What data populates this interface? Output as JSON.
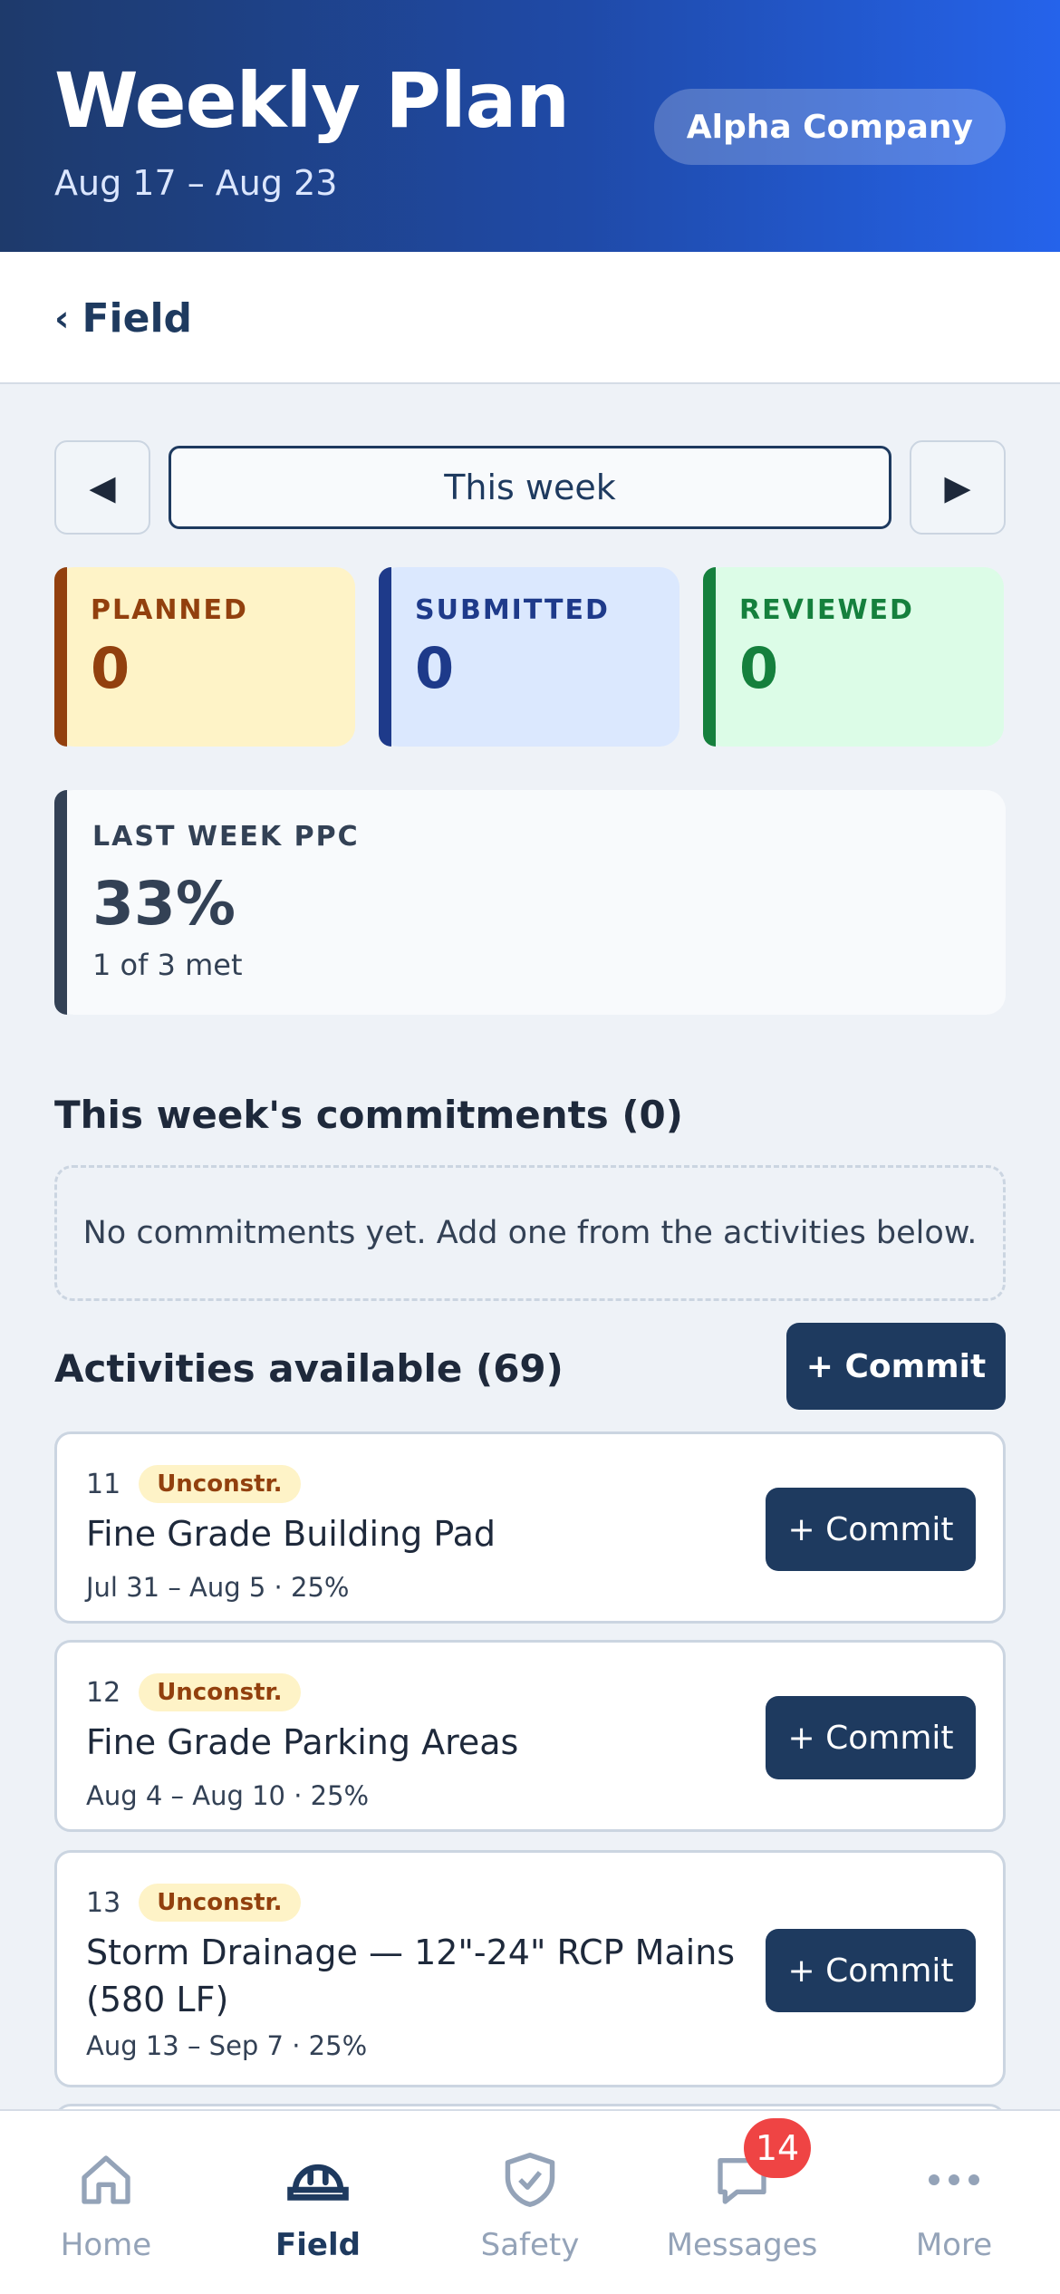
{
  "header": {
    "title": "Weekly Plan",
    "date_range": "Aug 17 – Aug 23",
    "company": "Alpha Company"
  },
  "back_nav": {
    "label": "Field",
    "icon": "chevron-left-icon"
  },
  "week_nav": {
    "prev_icon": "◀",
    "current": "This week",
    "next_icon": "▶"
  },
  "stats": [
    {
      "label": "PLANNED",
      "value": "0",
      "color": "#92400e"
    },
    {
      "label": "SUBMITTED",
      "value": "0",
      "color": "#1e3a8a"
    },
    {
      "label": "REVIEWED",
      "value": "0",
      "color": "#15803d"
    }
  ],
  "ppc": {
    "label": "LAST WEEK PPC",
    "value": "33%",
    "detail": "1 of 3 met"
  },
  "commitments": {
    "title": "This week's commitments (0)",
    "empty_message": "No commitments yet. Add one from the activities below."
  },
  "activities": {
    "title": "Activities available (69)",
    "commit_label": "+ Commit",
    "items": [
      {
        "id": "11",
        "badge": "Unconstr.",
        "name": "Fine Grade Building Pad",
        "meta": "Jul 31 – Aug 5 · 25%",
        "commit": "+ Commit"
      },
      {
        "id": "12",
        "badge": "Unconstr.",
        "name": "Fine Grade Parking Areas",
        "meta": "Aug 4 – Aug 10 · 25%",
        "commit": "+ Commit"
      },
      {
        "id": "13",
        "badge": "Unconstr.",
        "name": "Storm Drainage — 12\"-24\" RCP Mains (580 LF)",
        "meta": "Aug 13 – Sep 7 · 25%",
        "commit": "+ Commit"
      }
    ]
  },
  "tabbar": {
    "items": [
      {
        "label": "Home",
        "icon": "home-icon"
      },
      {
        "label": "Field",
        "icon": "hardhat-icon",
        "active": true
      },
      {
        "label": "Safety",
        "icon": "shield-check-icon"
      },
      {
        "label": "Messages",
        "icon": "message-icon",
        "badge": "14"
      },
      {
        "label": "More",
        "icon": "more-icon"
      }
    ]
  },
  "colors": {
    "accent": "#1e3a5f",
    "header_start": "#1e3a6b",
    "header_end": "#2563eb",
    "badge_red": "#ef4444"
  }
}
